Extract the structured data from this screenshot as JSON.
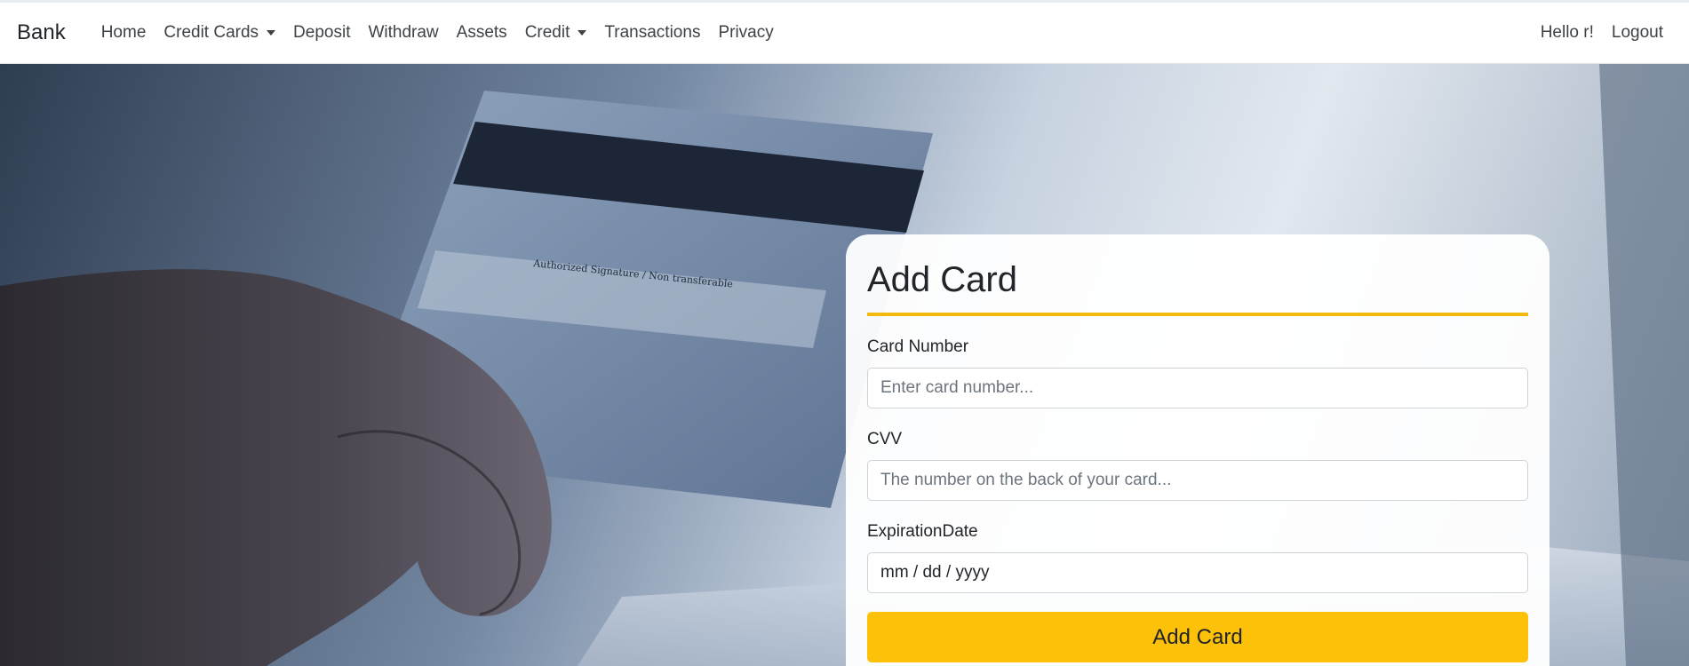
{
  "navbar": {
    "brand": "Bank",
    "items": [
      {
        "label": "Home",
        "dropdown": false
      },
      {
        "label": "Credit Cards",
        "dropdown": true
      },
      {
        "label": "Deposit",
        "dropdown": false
      },
      {
        "label": "Withdraw",
        "dropdown": false
      },
      {
        "label": "Assets",
        "dropdown": false
      },
      {
        "label": "Credit",
        "dropdown": true
      },
      {
        "label": "Transactions",
        "dropdown": false
      },
      {
        "label": "Privacy",
        "dropdown": false
      }
    ],
    "greeting": "Hello r!",
    "logout": "Logout"
  },
  "hero": {
    "background_image": "hand-holding-credit-card-photo"
  },
  "form": {
    "title": "Add Card",
    "card_number": {
      "label": "Card Number",
      "placeholder": "Enter card number..."
    },
    "cvv": {
      "label": "CVV",
      "placeholder": "The number on the back of your card..."
    },
    "expiration": {
      "label": "ExpirationDate",
      "value": "mm / dd / yyyy"
    },
    "submit_label": "Add Card"
  },
  "colors": {
    "accent": "#fcc108",
    "rule": "#f2b90f",
    "nav_text": "#3d4246"
  }
}
